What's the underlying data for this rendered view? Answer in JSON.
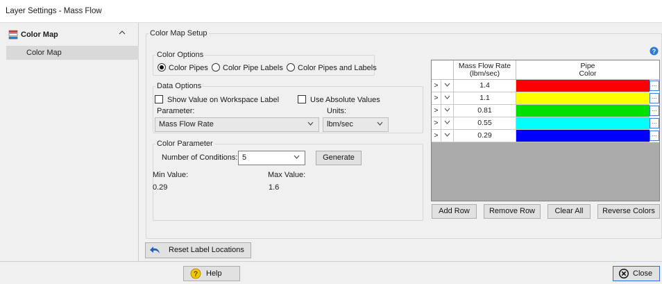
{
  "window": {
    "title": "Layer Settings - Mass Flow"
  },
  "sidebar": {
    "section_label": "Color Map",
    "items": [
      {
        "label": "Color Map"
      }
    ]
  },
  "setup": {
    "title": "Color Map Setup",
    "color_options": {
      "title": "Color Options",
      "options": [
        "Color Pipes",
        "Color Pipe Labels",
        "Color Pipes and Labels"
      ],
      "selected_index": 0
    },
    "data_options": {
      "title": "Data Options",
      "show_value_label": "Show Value on Workspace Label",
      "show_value_checked": false,
      "abs_values_label": "Use Absolute Values",
      "abs_values_checked": false,
      "parameter_label": "Parameter:",
      "parameter_value": "Mass Flow Rate",
      "units_label": "Units:",
      "units_value": "lbm/sec"
    },
    "color_parameter": {
      "title": "Color Parameter",
      "conditions_label": "Number of Conditions:",
      "conditions_value": "5",
      "generate_label": "Generate",
      "min_label": "Min Value:",
      "min_value": "0.29",
      "max_label": "Max Value:",
      "max_value": "1.6"
    },
    "reset_label": "Reset Label Locations"
  },
  "table": {
    "col_value_line1": "Mass Flow Rate",
    "col_value_line2": "(lbm/sec)",
    "col_color_line1": "Pipe",
    "col_color_line2": "Color",
    "rows": [
      {
        "arrow": ">",
        "value": "1.4",
        "color": "#ff0000"
      },
      {
        "arrow": ">",
        "value": "1.1",
        "color": "#ffff00"
      },
      {
        "arrow": ">",
        "value": "0.81",
        "color": "#00e000"
      },
      {
        "arrow": ">",
        "value": "0.55",
        "color": "#00ffff"
      },
      {
        "arrow": ">",
        "value": "0.29",
        "color": "#0000ff"
      }
    ],
    "ellipsis": "...",
    "buttons": {
      "add_row": "Add Row",
      "remove_row": "Remove Row",
      "clear_all": "Clear All",
      "reverse_colors": "Reverse Colors"
    }
  },
  "footer": {
    "help_label": "Help",
    "close_label": "Close"
  },
  "icons": {
    "chevron_up": "^",
    "chevron_down": "⌄",
    "dropdown": "∨",
    "help": "?",
    "close": "⊗"
  }
}
